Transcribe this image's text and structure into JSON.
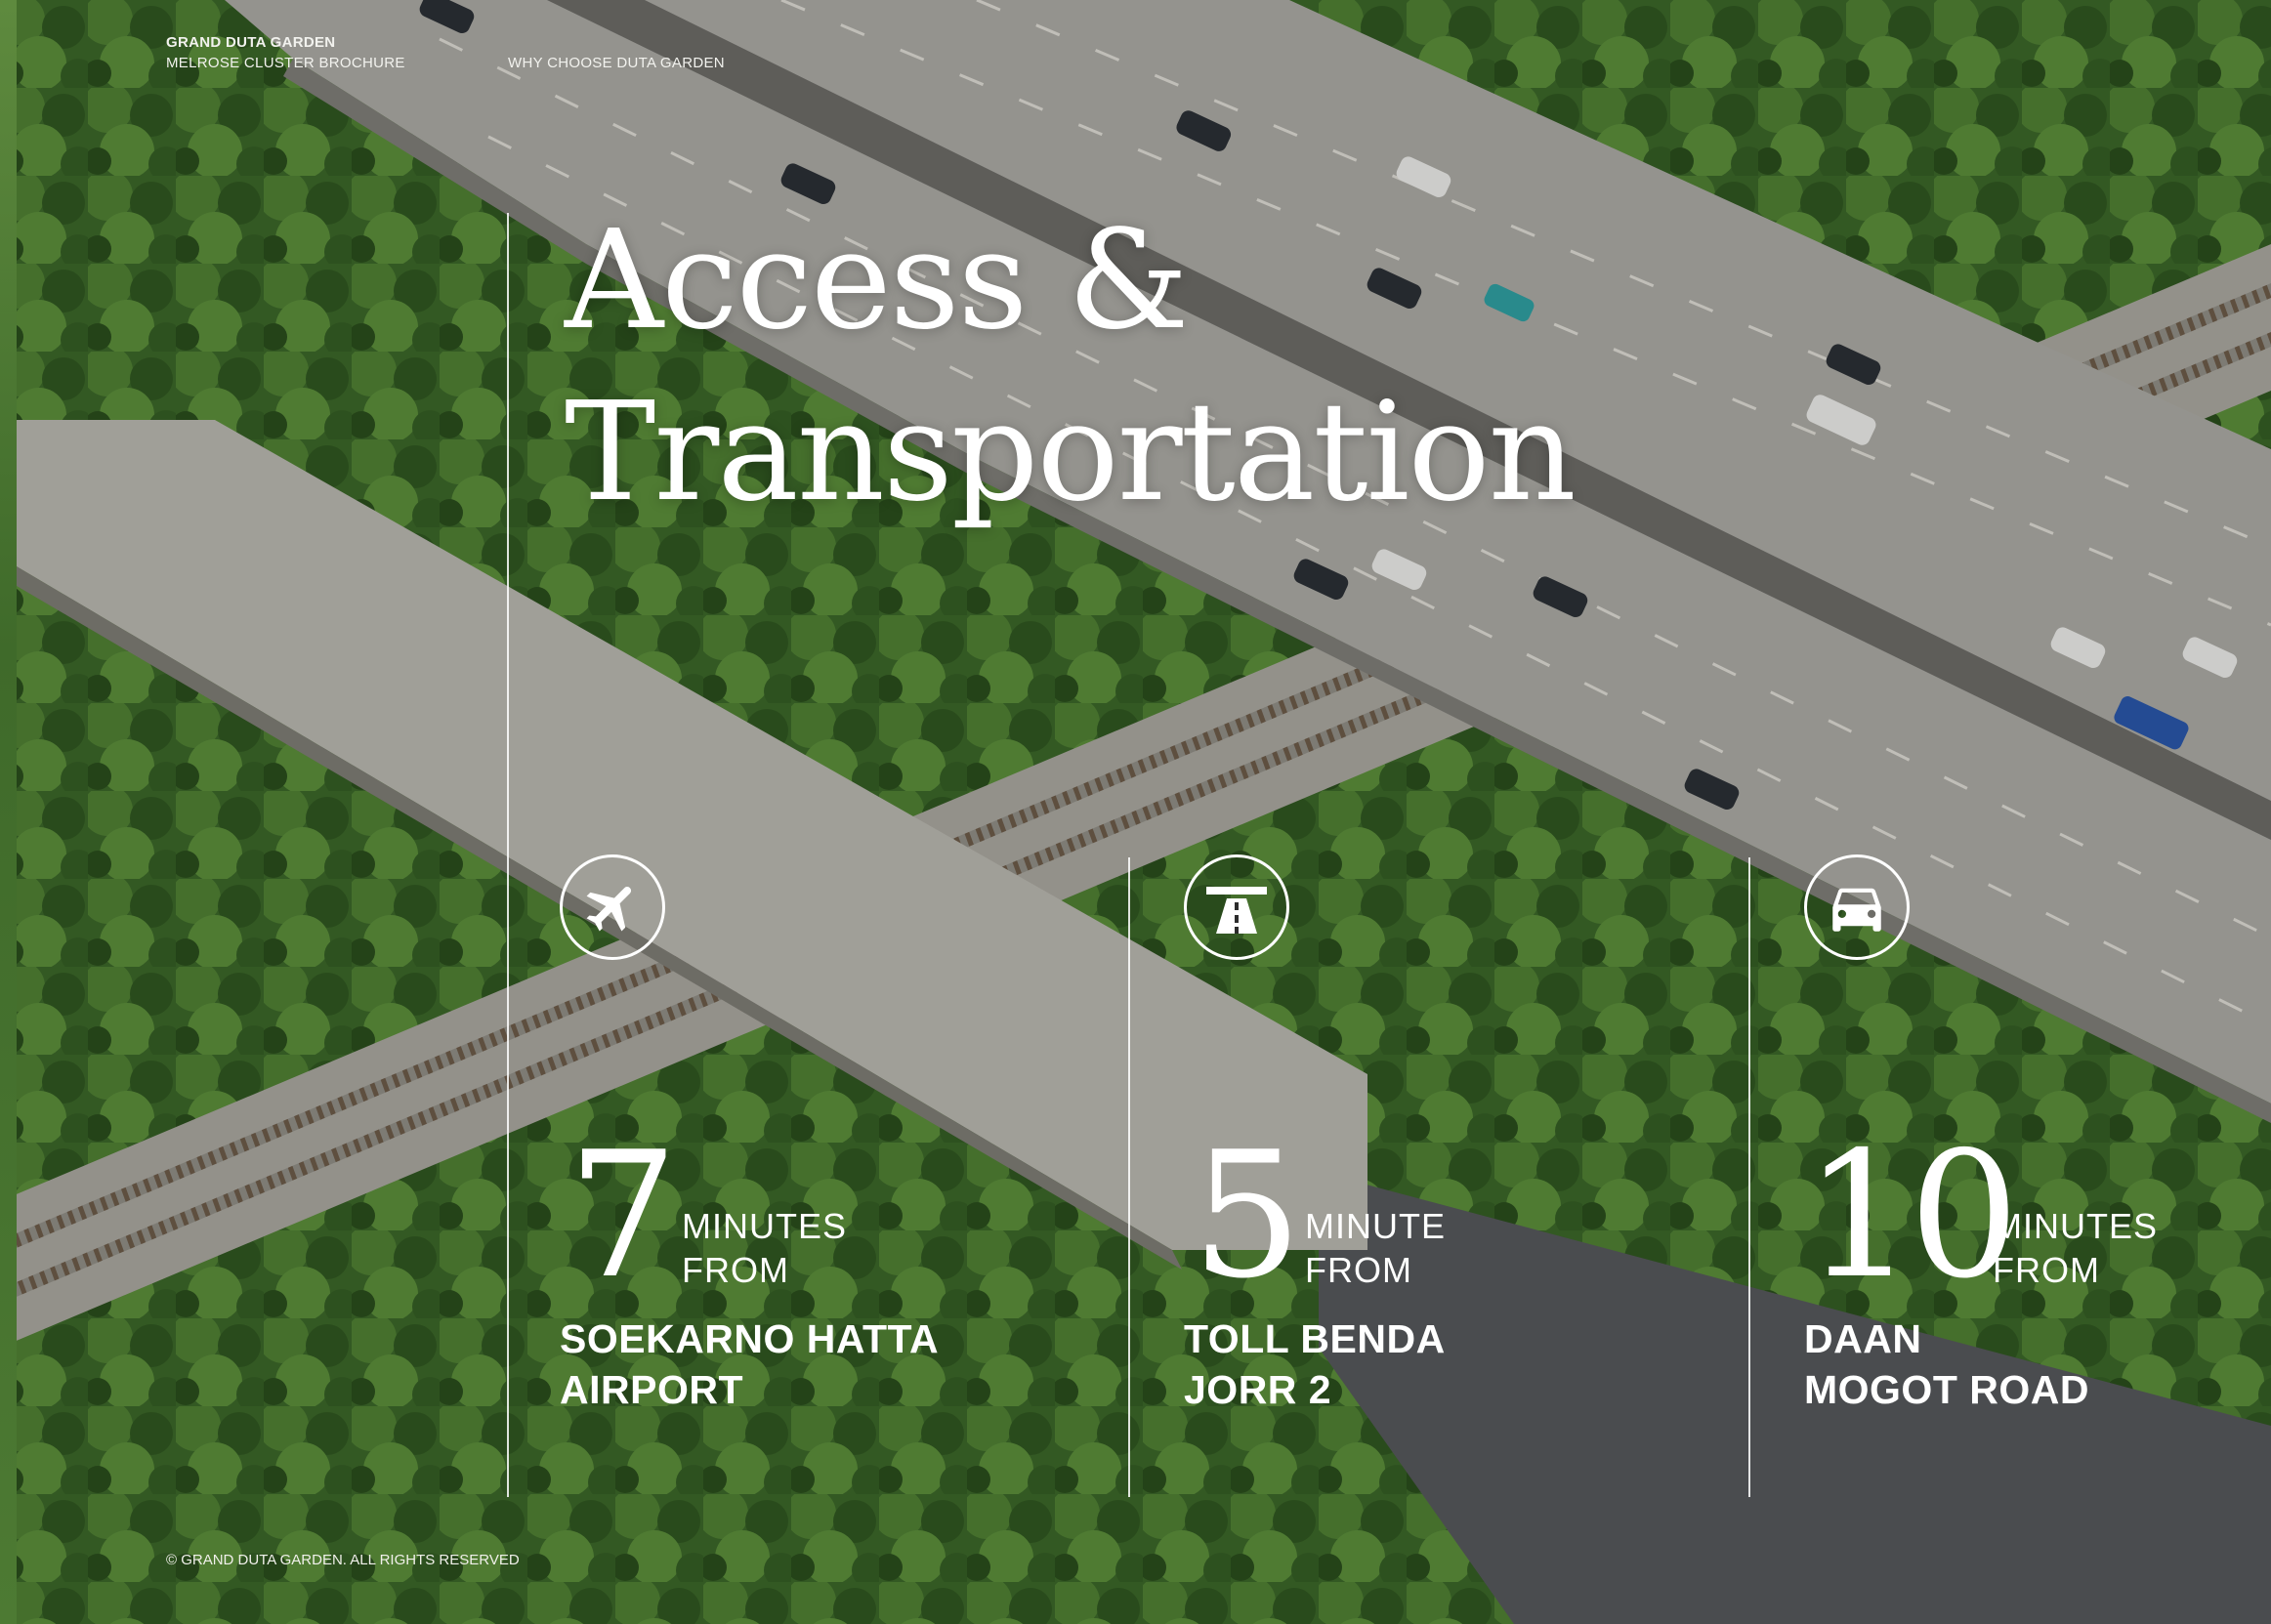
{
  "header": {
    "brand": "GRAND DUTA GARDEN",
    "subtitle": "MELROSE CLUSTER BROCHURE",
    "section": "WHY CHOOSE DUTA GARDEN"
  },
  "title": {
    "line1": "Access &",
    "line2": "Transportation"
  },
  "stats": [
    {
      "icon": "airplane-icon",
      "number": "7",
      "unit_line1": "MINUTES",
      "unit_line2": "FROM",
      "place_line1": "SOEKARNO HATTA",
      "place_line2": "AIRPORT"
    },
    {
      "icon": "highway-icon",
      "number": "5",
      "unit_line1": "MINUTE",
      "unit_line2": "FROM",
      "place_line1": "TOLL BENDA",
      "place_line2": "JORR 2"
    },
    {
      "icon": "car-icon",
      "number": "10",
      "unit_line1": "MINUTES",
      "unit_line2": "FROM",
      "place_line1": "DAAN",
      "place_line2": "MOGOT ROAD"
    }
  ],
  "footer": "© GRAND DUTA GARDEN. ALL RIGHTS RESERVED",
  "colors": {
    "forest": "#3d6a2c",
    "road": "#8a8a82",
    "text": "#ffffff"
  }
}
